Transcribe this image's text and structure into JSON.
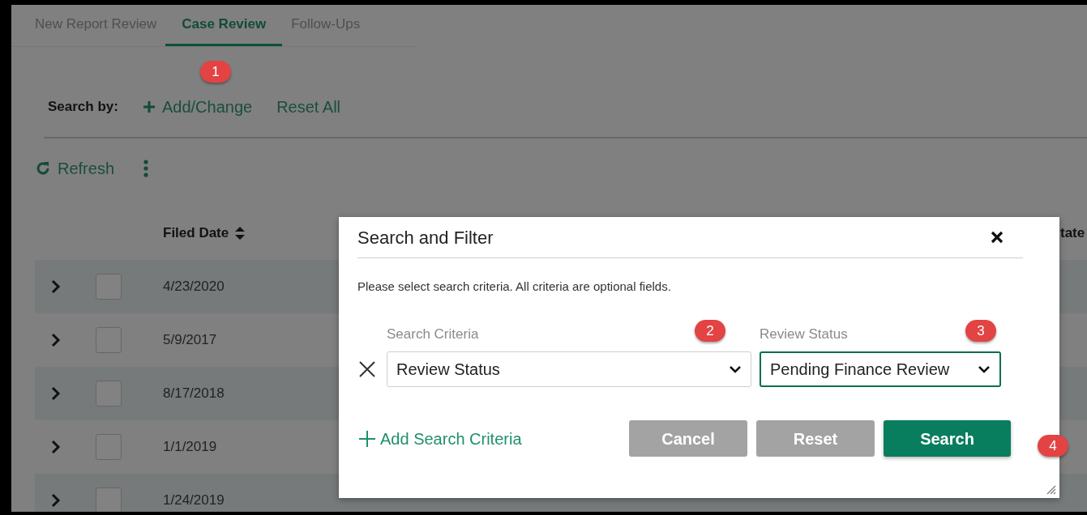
{
  "tabs": [
    {
      "label": "New Report Review",
      "selected": false
    },
    {
      "label": "Case Review",
      "selected": true
    },
    {
      "label": "Follow-Ups",
      "selected": false
    }
  ],
  "search_bar": {
    "label": "Search by:",
    "add_change": "Add/Change",
    "reset_all": "Reset All"
  },
  "toolbar": {
    "refresh": "Refresh"
  },
  "table": {
    "columns": {
      "filed_date": "Filed Date",
      "column_8": "tate"
    },
    "rows": [
      {
        "checked": false,
        "filed_date": "4/23/2020"
      },
      {
        "checked": false,
        "filed_date": "5/9/2017"
      },
      {
        "checked": false,
        "filed_date": "8/17/2018"
      },
      {
        "checked": false,
        "filed_date": "1/1/2019"
      },
      {
        "checked": false,
        "filed_date": "1/24/2019"
      }
    ]
  },
  "dialog": {
    "title": "Search and Filter",
    "description": "Please select search criteria. All criteria are optional fields.",
    "criteria": [
      {
        "label": "Search Criteria",
        "value": "Review Status",
        "focused": false
      },
      {
        "label": "Review Status",
        "value": "Pending Finance Review",
        "focused": true
      }
    ],
    "add_criteria": "Add Search Criteria",
    "buttons": [
      {
        "label": "Cancel",
        "kind": "secondary"
      },
      {
        "label": "Reset",
        "kind": "secondary"
      },
      {
        "label": "Search",
        "kind": "primary"
      }
    ]
  },
  "annotations": [
    {
      "number": "1"
    },
    {
      "number": "2"
    },
    {
      "number": "3"
    },
    {
      "number": "4"
    }
  ]
}
